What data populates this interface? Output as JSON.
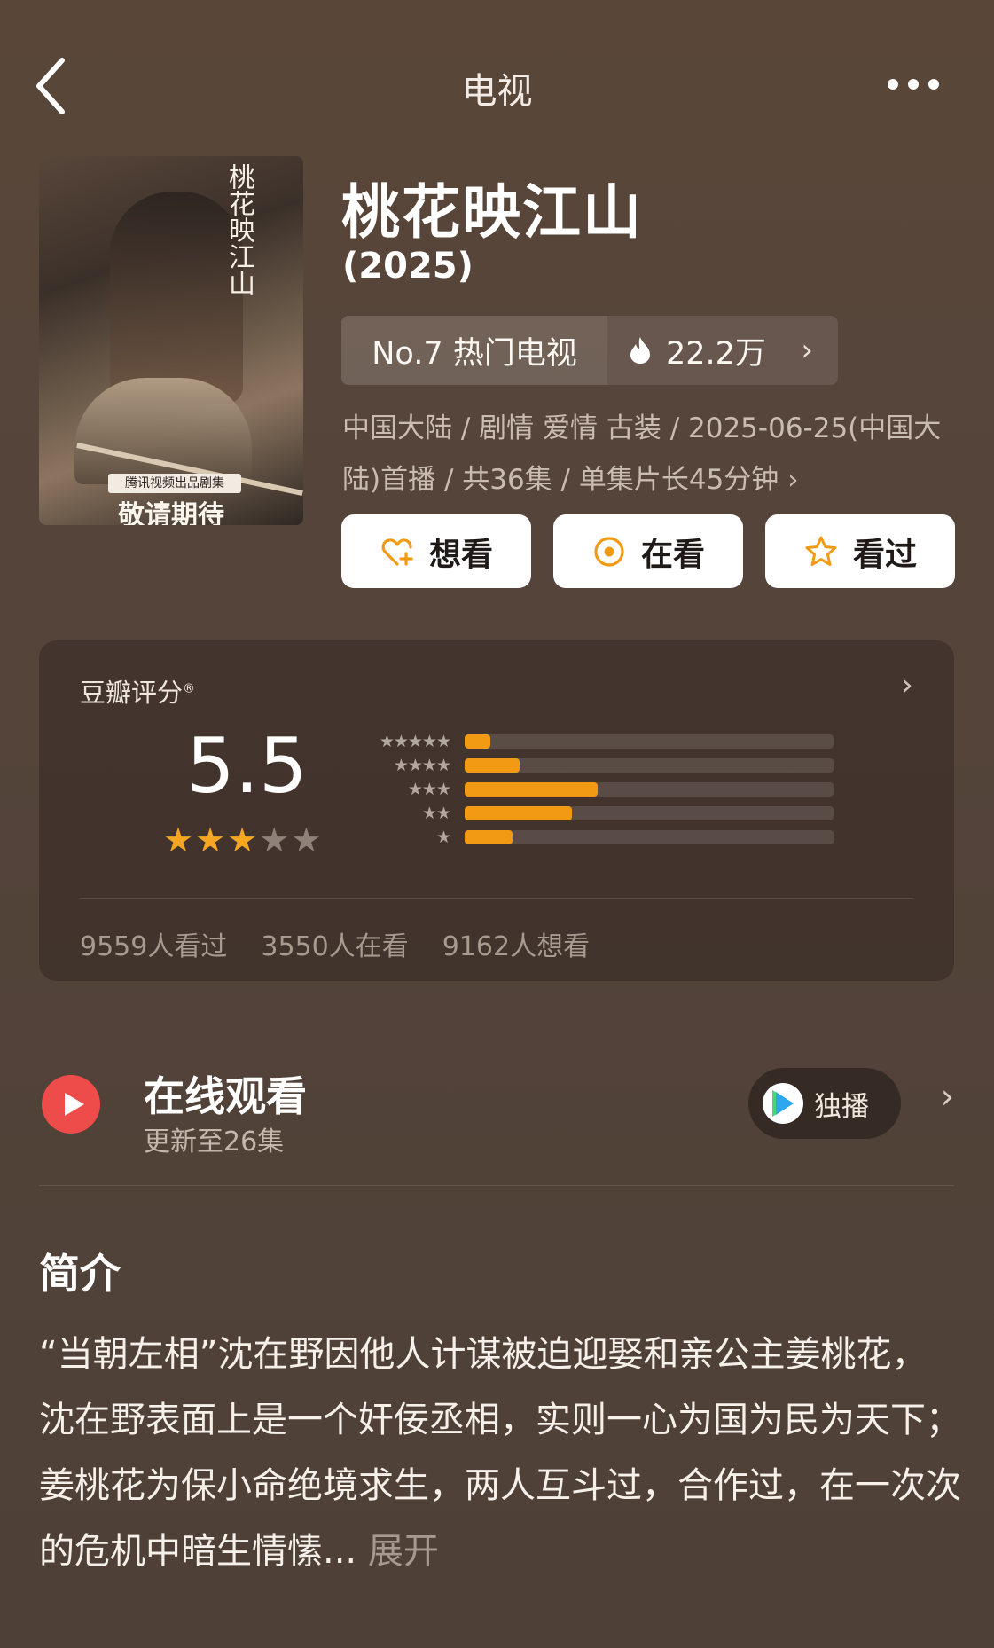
{
  "nav": {
    "title": "电视",
    "back_icon": "back-chevron-icon",
    "more_icon": "more-dots-icon"
  },
  "poster": {
    "calligraphy": "桃花映江山",
    "badge": "腾讯视频出品剧集",
    "tagline": "敬请期待"
  },
  "show": {
    "title": "桃花映江山",
    "year": "(2025)",
    "rank_text": "No.7 热门电视",
    "heat": "22.2万",
    "meta": "中国大陆 / 剧情 爱情 古装 / 2025-06-25(中国大陆)首播 / 共36集 / 单集片长45分钟 ›"
  },
  "actions": {
    "want": "想看",
    "watching": "在看",
    "watched": "看过"
  },
  "rating": {
    "label": "豆瓣评分",
    "registered": "®",
    "score": "5.5",
    "stars_filled": 3,
    "stars_total": 5,
    "distribution": [
      {
        "stars": "★★★★★",
        "percent": 7
      },
      {
        "stars": "★★★★",
        "percent": 15
      },
      {
        "stars": "★★★",
        "percent": 36
      },
      {
        "stars": "★★",
        "percent": 29
      },
      {
        "stars": "★",
        "percent": 13
      }
    ],
    "counts": {
      "watched": "9559人看过",
      "watching": "3550人在看",
      "want": "9162人想看"
    }
  },
  "watch": {
    "title": "在线观看",
    "subtitle": "更新至26集",
    "exclusive": "独播"
  },
  "synopsis": {
    "title": "简介",
    "text": "“当朝左相”沈在野因他人计谋被迫迎娶和亲公主姜桃花，沈在野表面上是一个奸佞丞相，实则一心为国为民为天下；姜桃花为保小命绝境求生，两人互斗过，合作过，在一次次的危机中暗生情愫...",
    "expand": "展开"
  },
  "colors": {
    "accent": "#f29a14",
    "play_red": "#ee4b4b"
  }
}
